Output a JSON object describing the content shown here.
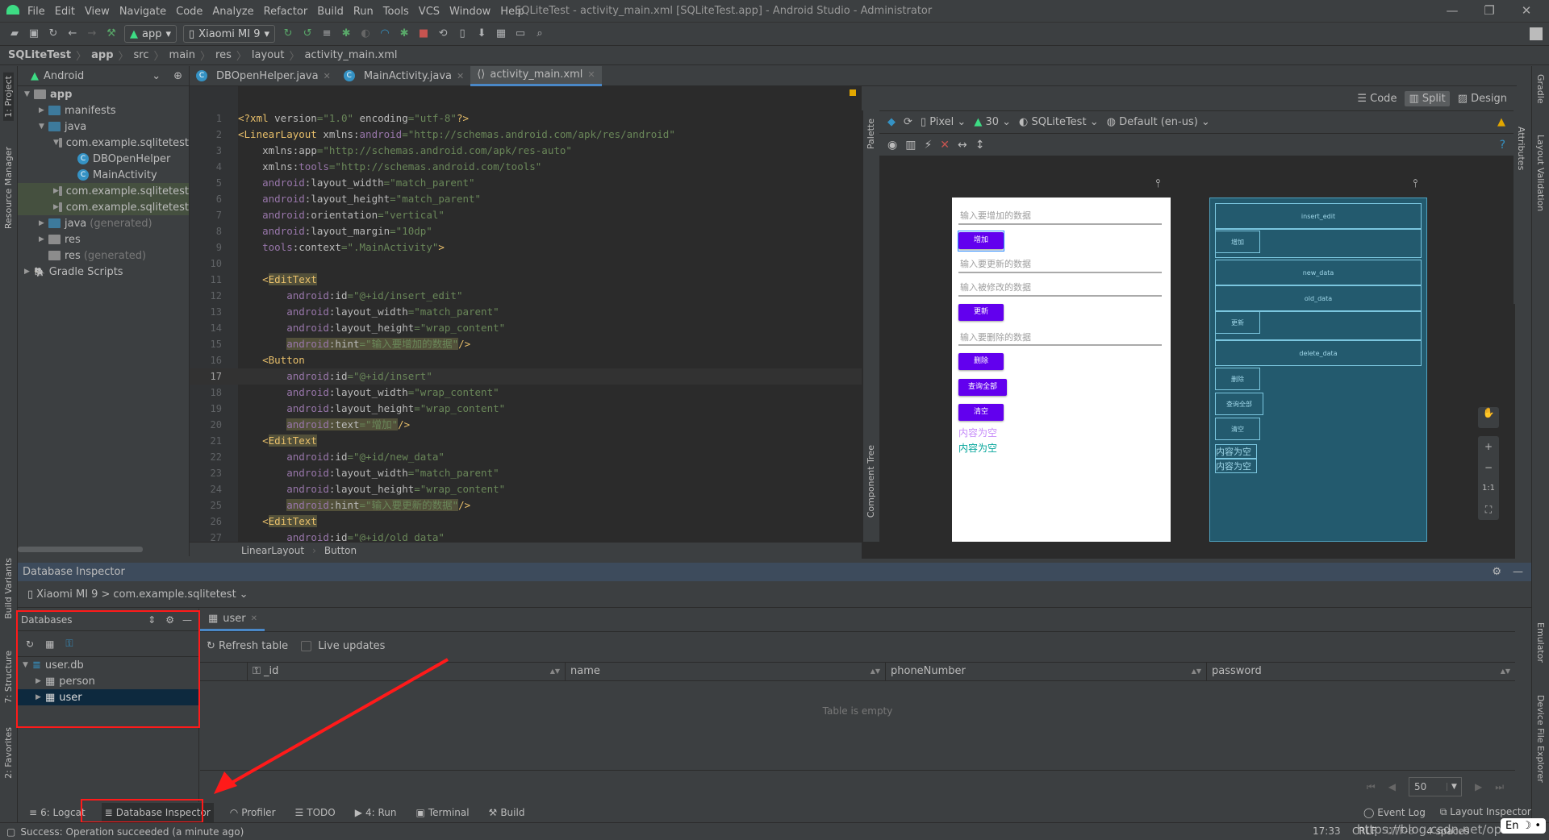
{
  "window": {
    "title": "SQLiteTest - activity_main.xml [SQLiteTest.app] - Android Studio - Administrator"
  },
  "menu": [
    "File",
    "Edit",
    "View",
    "Navigate",
    "Code",
    "Analyze",
    "Refactor",
    "Build",
    "Run",
    "Tools",
    "VCS",
    "Window",
    "Help"
  ],
  "toolbar": {
    "run_config": "app",
    "device": "Xiaomi MI 9"
  },
  "breadcrumb": [
    "SQLiteTest",
    "app",
    "src",
    "main",
    "res",
    "layout",
    "activity_main.xml"
  ],
  "left_stripe": {
    "project": "1: Project",
    "resource_manager": "Resource Manager",
    "build_variants": "Build Variants",
    "structure": "7: Structure",
    "favorites": "2: Favorites"
  },
  "right_stripe": {
    "gradle": "Gradle",
    "layout_validation": "Layout Validation",
    "emulator": "Emulator",
    "device_file_explorer": "Device File Explorer",
    "attributes": "Attributes"
  },
  "project": {
    "view": "Android",
    "tree": [
      {
        "label": "app",
        "depth": 0,
        "arrow": "▼",
        "icon": "folder-module",
        "bold": true
      },
      {
        "label": "manifests",
        "depth": 1,
        "arrow": "▶",
        "icon": "folder"
      },
      {
        "label": "java",
        "depth": 1,
        "arrow": "▼",
        "icon": "folder"
      },
      {
        "label": "com.example.sqlitetest",
        "depth": 2,
        "arrow": "▼",
        "icon": "package"
      },
      {
        "label": "DBOpenHelper",
        "depth": 3,
        "arrow": "",
        "icon": "class"
      },
      {
        "label": "MainActivity",
        "depth": 3,
        "arrow": "",
        "icon": "class"
      },
      {
        "label": "com.example.sqlitetest",
        "depth": 2,
        "arrow": "▶",
        "icon": "package",
        "hl": true
      },
      {
        "label": "com.example.sqlitetest",
        "depth": 2,
        "arrow": "▶",
        "icon": "package",
        "hl": true
      },
      {
        "label": "java",
        "suffix": "(generated)",
        "depth": 1,
        "arrow": "▶",
        "icon": "folder"
      },
      {
        "label": "res",
        "depth": 1,
        "arrow": "▶",
        "icon": "folder-res"
      },
      {
        "label": "res",
        "suffix": "(generated)",
        "depth": 1,
        "arrow": "",
        "icon": "folder-res"
      },
      {
        "label": "Gradle Scripts",
        "depth": 0,
        "arrow": "▶",
        "icon": "gradle"
      }
    ]
  },
  "editor": {
    "tabs": [
      {
        "label": "DBOpenHelper.java",
        "icon": "class"
      },
      {
        "label": "MainActivity.java",
        "icon": "class"
      },
      {
        "label": "activity_main.xml",
        "icon": "xml",
        "active": true
      }
    ],
    "current_line": 17,
    "lines": [
      [
        [
          "t",
          "<?xml "
        ],
        [
          "a",
          "version"
        ],
        [
          "v",
          "=\"1.0\" "
        ],
        [
          "a",
          "encoding"
        ],
        [
          "v",
          "=\"utf-8\""
        ],
        [
          "t",
          "?>"
        ]
      ],
      [
        [
          "t",
          "<LinearLayout "
        ],
        [
          "a",
          "xmlns:"
        ],
        [
          "n",
          "android"
        ],
        [
          "v",
          "=\"http://schemas.android.com/apk/res/android\""
        ]
      ],
      [
        [
          "p",
          "    "
        ],
        [
          "a",
          "xmlns:app"
        ],
        [
          "v",
          "=\"http://schemas.android.com/apk/res-auto\""
        ]
      ],
      [
        [
          "p",
          "    "
        ],
        [
          "a",
          "xmlns:"
        ],
        [
          "n",
          "tools"
        ],
        [
          "v",
          "=\"http://schemas.android.com/tools\""
        ]
      ],
      [
        [
          "p",
          "    "
        ],
        [
          "n",
          "android"
        ],
        [
          "a",
          ":layout_width"
        ],
        [
          "v",
          "=\"match_parent\""
        ]
      ],
      [
        [
          "p",
          "    "
        ],
        [
          "n",
          "android"
        ],
        [
          "a",
          ":layout_height"
        ],
        [
          "v",
          "=\"match_parent\""
        ]
      ],
      [
        [
          "p",
          "    "
        ],
        [
          "n",
          "android"
        ],
        [
          "a",
          ":orientation"
        ],
        [
          "v",
          "=\"vertical\""
        ]
      ],
      [
        [
          "p",
          "    "
        ],
        [
          "n",
          "android"
        ],
        [
          "a",
          ":layout_margin"
        ],
        [
          "v",
          "=\"10dp\""
        ]
      ],
      [
        [
          "p",
          "    "
        ],
        [
          "n",
          "tools"
        ],
        [
          "a",
          ":context"
        ],
        [
          "v",
          "=\".MainActivity\""
        ],
        [
          "t",
          ">"
        ]
      ],
      [],
      [
        [
          "p",
          "    "
        ],
        [
          "t",
          "<"
        ],
        [
          "t h",
          "EditText"
        ]
      ],
      [
        [
          "p",
          "        "
        ],
        [
          "n",
          "android"
        ],
        [
          "a",
          ":id"
        ],
        [
          "v",
          "=\"@+id/insert_edit\""
        ]
      ],
      [
        [
          "p",
          "        "
        ],
        [
          "n",
          "android"
        ],
        [
          "a",
          ":layout_width"
        ],
        [
          "v",
          "=\"match_parent\""
        ]
      ],
      [
        [
          "p",
          "        "
        ],
        [
          "n",
          "android"
        ],
        [
          "a",
          ":layout_height"
        ],
        [
          "v",
          "=\"wrap_content\""
        ]
      ],
      [
        [
          "p",
          "        "
        ],
        [
          "n h",
          "android"
        ],
        [
          "a h",
          ":hint"
        ],
        [
          "v h",
          "=\"输入要增加的数据\""
        ],
        [
          "t",
          "/>"
        ]
      ],
      [
        [
          "p",
          "    "
        ],
        [
          "t",
          "<Button"
        ]
      ],
      [
        [
          "p",
          "        "
        ],
        [
          "n",
          "android"
        ],
        [
          "a",
          ":id"
        ],
        [
          "v",
          "=\"@+id/insert\""
        ]
      ],
      [
        [
          "p",
          "        "
        ],
        [
          "n",
          "android"
        ],
        [
          "a",
          ":layout_width"
        ],
        [
          "v",
          "=\"wrap_content\""
        ]
      ],
      [
        [
          "p",
          "        "
        ],
        [
          "n",
          "android"
        ],
        [
          "a",
          ":layout_height"
        ],
        [
          "v",
          "=\"wrap_content\""
        ]
      ],
      [
        [
          "p",
          "        "
        ],
        [
          "n h",
          "android"
        ],
        [
          "a h",
          ":text"
        ],
        [
          "v h",
          "=\"增加\""
        ],
        [
          "t",
          "/>"
        ]
      ],
      [
        [
          "p",
          "    "
        ],
        [
          "t",
          "<"
        ],
        [
          "t h",
          "EditText"
        ]
      ],
      [
        [
          "p",
          "        "
        ],
        [
          "n",
          "android"
        ],
        [
          "a",
          ":id"
        ],
        [
          "v",
          "=\"@+id/new_data\""
        ]
      ],
      [
        [
          "p",
          "        "
        ],
        [
          "n",
          "android"
        ],
        [
          "a",
          ":layout_width"
        ],
        [
          "v",
          "=\"match_parent\""
        ]
      ],
      [
        [
          "p",
          "        "
        ],
        [
          "n",
          "android"
        ],
        [
          "a",
          ":layout_height"
        ],
        [
          "v",
          "=\"wrap_content\""
        ]
      ],
      [
        [
          "p",
          "        "
        ],
        [
          "n h",
          "android"
        ],
        [
          "a h",
          ":hint"
        ],
        [
          "v h",
          "=\"输入要更新的数据\""
        ],
        [
          "t",
          "/>"
        ]
      ],
      [
        [
          "p",
          "    "
        ],
        [
          "t",
          "<"
        ],
        [
          "t h",
          "EditText"
        ]
      ],
      [
        [
          "p",
          "        "
        ],
        [
          "n",
          "android"
        ],
        [
          "a",
          ":id"
        ],
        [
          "v",
          "=\"@+id/old_data\""
        ]
      ]
    ],
    "structure_crumb": [
      "LinearLayout",
      "Button"
    ]
  },
  "design": {
    "modes": [
      "Code",
      "Split",
      "Design"
    ],
    "active_mode": "Split",
    "palette": "Palette",
    "component_tree": "Component Tree",
    "device": "Pixel",
    "api": "30",
    "theme": "SQLiteTest",
    "locale": "Default (en-us)",
    "zoom": {
      "fit": "1:1",
      "plus": "+",
      "minus": "−"
    },
    "preview": {
      "hints": [
        "输入要增加的数据",
        "输入要更新的数据",
        "输入被修改的数据",
        "输入要删除的数据"
      ],
      "buttons": [
        "增加",
        "更新",
        "删除",
        "查询全部",
        "清空"
      ],
      "texts": [
        {
          "text": "内容为空",
          "color": "#c58af9"
        },
        {
          "text": "内容为空",
          "color": "#03a59a"
        }
      ],
      "button_color": "#6200ee"
    },
    "blueprint": {
      "ids": [
        "insert_edit",
        "new_data",
        "old_data",
        "delete_data"
      ]
    }
  },
  "db_inspector": {
    "title": "Database Inspector",
    "device": "Xiaomi MI 9",
    "process": "com.example.sqlitetest",
    "databases_label": "Databases",
    "tree": [
      {
        "label": "user.db",
        "arrow": "▼",
        "depth": 0,
        "icon": "database"
      },
      {
        "label": "person",
        "arrow": "▶",
        "depth": 1,
        "icon": "table"
      },
      {
        "label": "user",
        "arrow": "▶",
        "depth": 1,
        "icon": "table",
        "selected": true
      }
    ],
    "open_tab": "user",
    "refresh": "Refresh table",
    "live_updates": "Live updates",
    "live_updates_checked": false,
    "columns": [
      "_id",
      "name",
      "phoneNumber",
      "password"
    ],
    "empty": "Table is empty",
    "page_size": "50"
  },
  "bottom_tabs": [
    {
      "label": "6: Logcat"
    },
    {
      "label": "Database Inspector",
      "active": true
    },
    {
      "label": "Profiler"
    },
    {
      "label": "TODO"
    },
    {
      "label": "4: Run"
    },
    {
      "label": "Terminal"
    },
    {
      "label": "Build"
    }
  ],
  "bottom_right_tabs": [
    "Event Log",
    "Layout Inspector"
  ],
  "status": {
    "message": "Success: Operation succeeded (a minute ago)",
    "time": "17:33",
    "line_sep": "CRLF",
    "encoding": "UTF-8",
    "indent": "4 spaces",
    "ime": "En"
  },
  "watermark": "https://blog.csdn.net/op520"
}
